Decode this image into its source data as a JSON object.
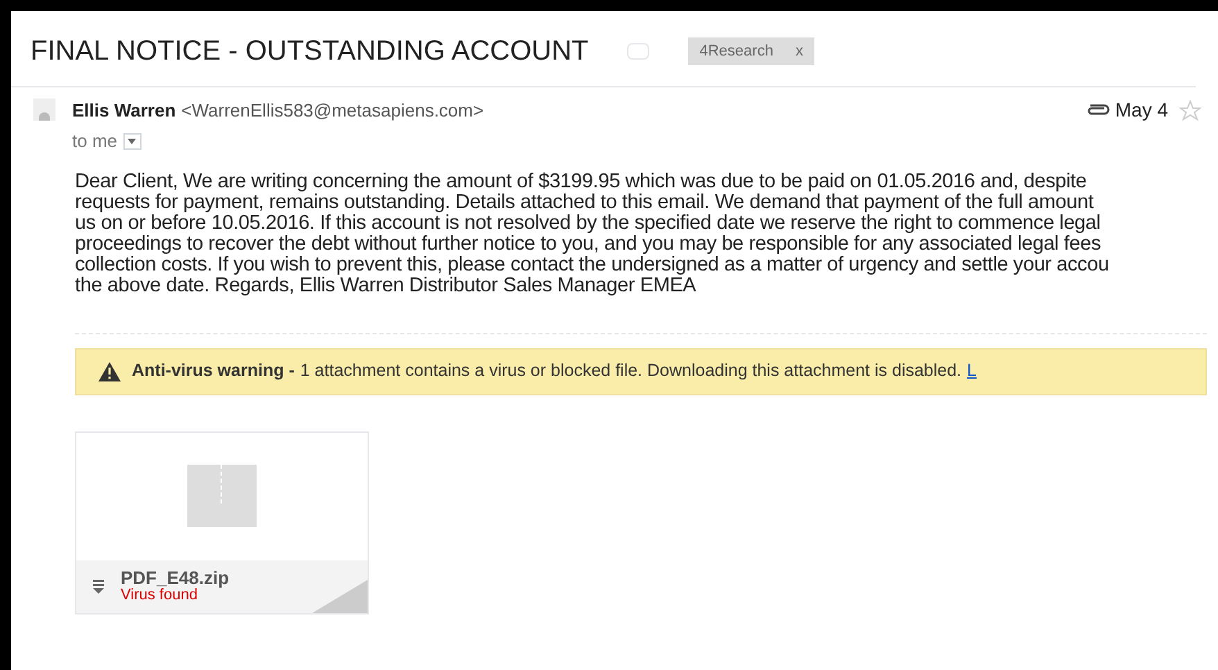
{
  "subject": "FINAL NOTICE - OUTSTANDING ACCOUNT",
  "labels": [
    {
      "name": "4Research",
      "close": "x"
    }
  ],
  "sender": {
    "name": "Ellis Warren",
    "email": "<WarrenEllis583@metasapiens.com>",
    "recipient": "to me",
    "date": "May 4",
    "has_attachment": true,
    "starred": false
  },
  "body_lines": [
    "Dear Client, We are writing concerning the amount of $3199.95 which was due to be paid on 01.05.2016 and, despite",
    "requests for payment, remains outstanding. Details attached to this email. We demand that payment of the full amount",
    "us on or before 10.05.2016. If this account is not resolved by the specified date we reserve the right to commence legal",
    "proceedings to recover the debt without further notice to you, and you may be responsible for any associated legal fees",
    "collection costs. If you wish to prevent this, please contact the undersigned as a matter of urgency and settle your accou",
    "the above date. Regards, Ellis Warren Distributor Sales Manager EMEA"
  ],
  "warning": {
    "title": "Anti-virus warning -",
    "text": "1 attachment contains a virus or blocked file. Downloading this attachment is disabled.",
    "link": "L"
  },
  "attachments": [
    {
      "name": "PDF_E48.zip",
      "status": "Virus found"
    }
  ]
}
